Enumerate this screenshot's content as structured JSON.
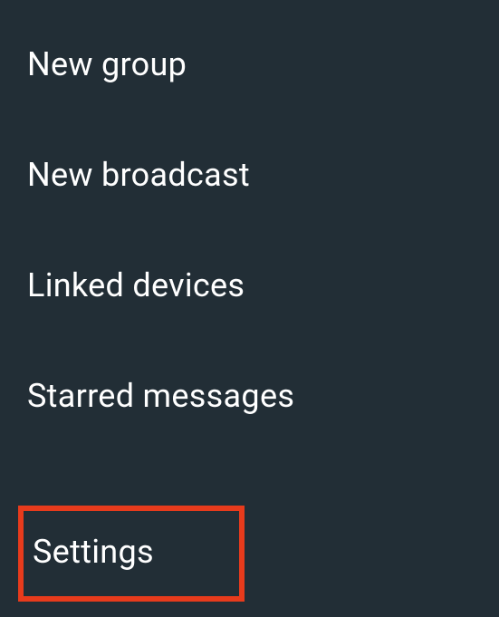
{
  "menu": {
    "items": [
      {
        "label": "New group"
      },
      {
        "label": "New broadcast"
      },
      {
        "label": "Linked devices"
      },
      {
        "label": "Starred messages"
      },
      {
        "label": "Settings"
      }
    ]
  }
}
